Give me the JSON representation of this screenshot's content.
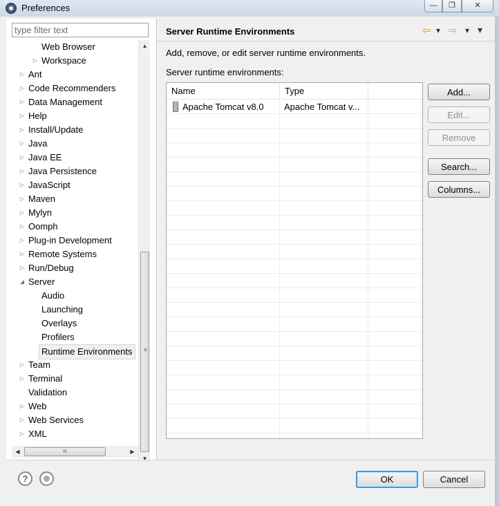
{
  "window": {
    "title": "Preferences",
    "controls": {
      "minimize": "—",
      "maximize": "❐",
      "close": "✕"
    }
  },
  "left": {
    "filter_placeholder": "type filter text",
    "tree": [
      {
        "label": "Web Browser",
        "level": 2,
        "twisty": ""
      },
      {
        "label": "Workspace",
        "level": 2,
        "twisty": "▷"
      },
      {
        "label": "Ant",
        "level": 1,
        "twisty": "▷"
      },
      {
        "label": "Code Recommenders",
        "level": 1,
        "twisty": "▷"
      },
      {
        "label": "Data Management",
        "level": 1,
        "twisty": "▷"
      },
      {
        "label": "Help",
        "level": 1,
        "twisty": "▷"
      },
      {
        "label": "Install/Update",
        "level": 1,
        "twisty": "▷"
      },
      {
        "label": "Java",
        "level": 1,
        "twisty": "▷"
      },
      {
        "label": "Java EE",
        "level": 1,
        "twisty": "▷"
      },
      {
        "label": "Java Persistence",
        "level": 1,
        "twisty": "▷"
      },
      {
        "label": "JavaScript",
        "level": 1,
        "twisty": "▷"
      },
      {
        "label": "Maven",
        "level": 1,
        "twisty": "▷"
      },
      {
        "label": "Mylyn",
        "level": 1,
        "twisty": "▷"
      },
      {
        "label": "Oomph",
        "level": 1,
        "twisty": "▷"
      },
      {
        "label": "Plug-in Development",
        "level": 1,
        "twisty": "▷"
      },
      {
        "label": "Remote Systems",
        "level": 1,
        "twisty": "▷"
      },
      {
        "label": "Run/Debug",
        "level": 1,
        "twisty": "▷"
      },
      {
        "label": "Server",
        "level": 1,
        "twisty": "◢"
      },
      {
        "label": "Audio",
        "level": 2,
        "twisty": ""
      },
      {
        "label": "Launching",
        "level": 2,
        "twisty": ""
      },
      {
        "label": "Overlays",
        "level": 2,
        "twisty": ""
      },
      {
        "label": "Profilers",
        "level": 2,
        "twisty": ""
      },
      {
        "label": "Runtime Environments",
        "level": 2,
        "twisty": "",
        "selected": true
      },
      {
        "label": "Team",
        "level": 1,
        "twisty": "▷"
      },
      {
        "label": "Terminal",
        "level": 1,
        "twisty": "▷"
      },
      {
        "label": "Validation",
        "level": 1,
        "twisty": ""
      },
      {
        "label": "Web",
        "level": 1,
        "twisty": "▷"
      },
      {
        "label": "Web Services",
        "level": 1,
        "twisty": "▷"
      },
      {
        "label": "XML",
        "level": 1,
        "twisty": "▷"
      }
    ],
    "scroll": {
      "up": "▲",
      "down": "▼",
      "left": "◀",
      "right": "▶",
      "grip_h": "III",
      "grip_v": "≡"
    }
  },
  "right": {
    "title": "Server Runtime Environments",
    "nav": {
      "back": "⇦",
      "back_menu": "▾",
      "forward": "⇨",
      "forward_menu": "▾",
      "view_menu": "▾"
    },
    "description": "Add, remove, or edit server runtime environments.",
    "table_label": "Server runtime environments:",
    "table": {
      "columns": [
        "Name",
        "Type"
      ],
      "rows": [
        {
          "name": "Apache Tomcat v8.0",
          "type": "Apache Tomcat v..."
        }
      ]
    },
    "buttons": {
      "add": "Add...",
      "edit": "Edit...",
      "remove": "Remove",
      "search": "Search...",
      "columns": "Columns..."
    }
  },
  "bottom": {
    "help_icon": "?",
    "ok": "OK",
    "cancel": "Cancel"
  }
}
